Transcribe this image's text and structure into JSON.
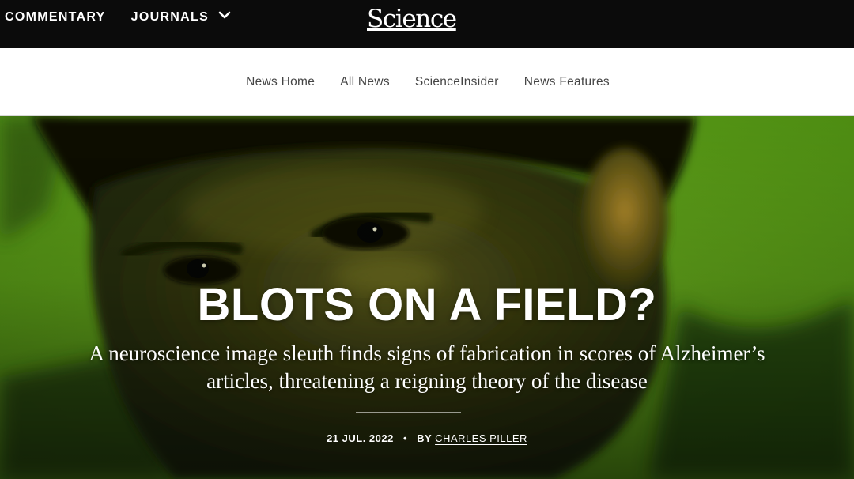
{
  "topnav": {
    "commentary": "COMMENTARY",
    "journals": "JOURNALS",
    "logo": "Science"
  },
  "subnav": {
    "items": [
      {
        "label": "News Home"
      },
      {
        "label": "All News"
      },
      {
        "label": "ScienceInsider"
      },
      {
        "label": "News Features"
      }
    ]
  },
  "hero": {
    "headline": "BLOTS ON A FIELD?",
    "dek_line1": "A neuroscience image sleuth finds signs of fabrication in scores of Alzheimer’s",
    "dek_line2": "articles, threatening a reigning theory of the disease",
    "date": "21 JUL. 2022",
    "separator": "•",
    "by": "BY",
    "author": "CHARLES PILLER"
  },
  "colors": {
    "topbar": "#0b0b0b",
    "subnav_bg": "#ffffff",
    "subnav_text": "#444444",
    "hero_green": "#61a31d",
    "text_white": "#ffffff"
  },
  "icons": {
    "journals_dropdown": "chevron-down-icon"
  }
}
